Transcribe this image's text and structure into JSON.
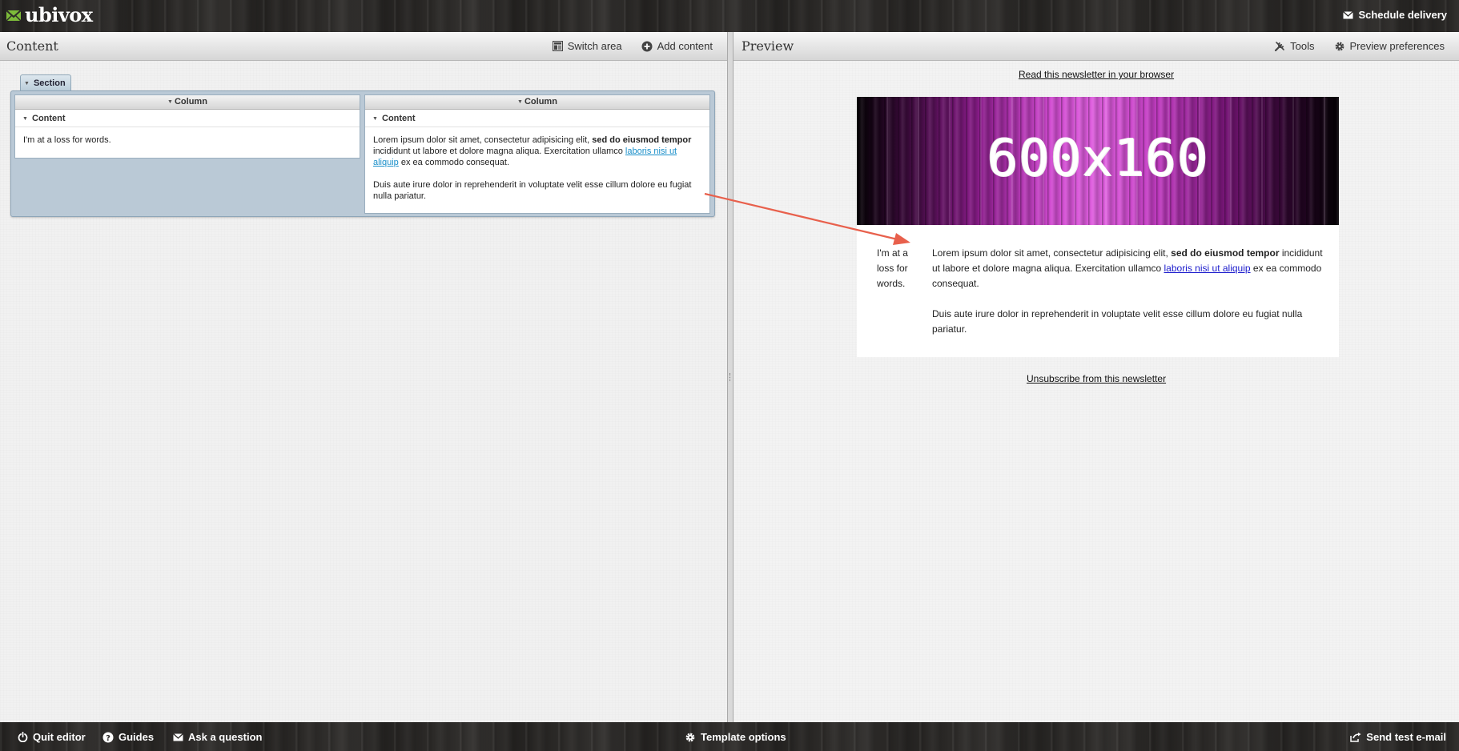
{
  "app": {
    "logo_text": "ubivox",
    "schedule_label": "Schedule delivery"
  },
  "left_panel": {
    "title": "Content",
    "switch_area_label": "Switch area",
    "add_content_label": "Add content",
    "section": {
      "tab_label": "Section",
      "columns": [
        {
          "header": "Column",
          "content_header": "Content",
          "text": "I'm at a loss for words."
        },
        {
          "header": "Column",
          "content_header": "Content",
          "p1_a": "Lorem ipsum dolor sit amet, consectetur adipisicing elit, ",
          "p1_bold": "sed do eiusmod tempor",
          "p1_b": " incididunt ut labore et dolore magna aliqua. Exercitation ullamco ",
          "p1_link": "laboris nisi ut aliquip",
          "p1_c": " ex ea commodo consequat.",
          "p2": "Duis aute irure dolor in reprehenderit in voluptate velit esse cillum dolore eu fugiat nulla pariatur."
        }
      ]
    }
  },
  "right_panel": {
    "title": "Preview",
    "tools_label": "Tools",
    "preferences_label": "Preview preferences",
    "read_link": "Read this newsletter in your browser",
    "banner_text": "600x160",
    "left_text": "I'm at a loss for words.",
    "p1_a": "Lorem ipsum dolor sit amet, consectetur adipisicing elit, ",
    "p1_bold": "sed do eiusmod tempor",
    "p1_b": " incididunt ut labore et dolore magna aliqua. Exercitation ullamco ",
    "p1_link": "laboris nisi ut aliquip",
    "p1_c": " ex ea commodo consequat.",
    "p2": "Duis aute irure dolor in reprehenderit in voluptate velit esse cillum dolore eu fugiat nulla pariatur.",
    "unsubscribe_link": "Unsubscribe from this newsletter"
  },
  "bottom_bar": {
    "quit_label": "Quit editor",
    "guides_label": "Guides",
    "ask_label": "Ask a question",
    "template_label": "Template options",
    "send_test_label": "Send test e-mail"
  },
  "colors": {
    "annotation_arrow": "#e8604c",
    "link_editor": "#1a8fc9",
    "link_preview": "#1a1acc",
    "logo_accent": "#7dbb3a"
  }
}
